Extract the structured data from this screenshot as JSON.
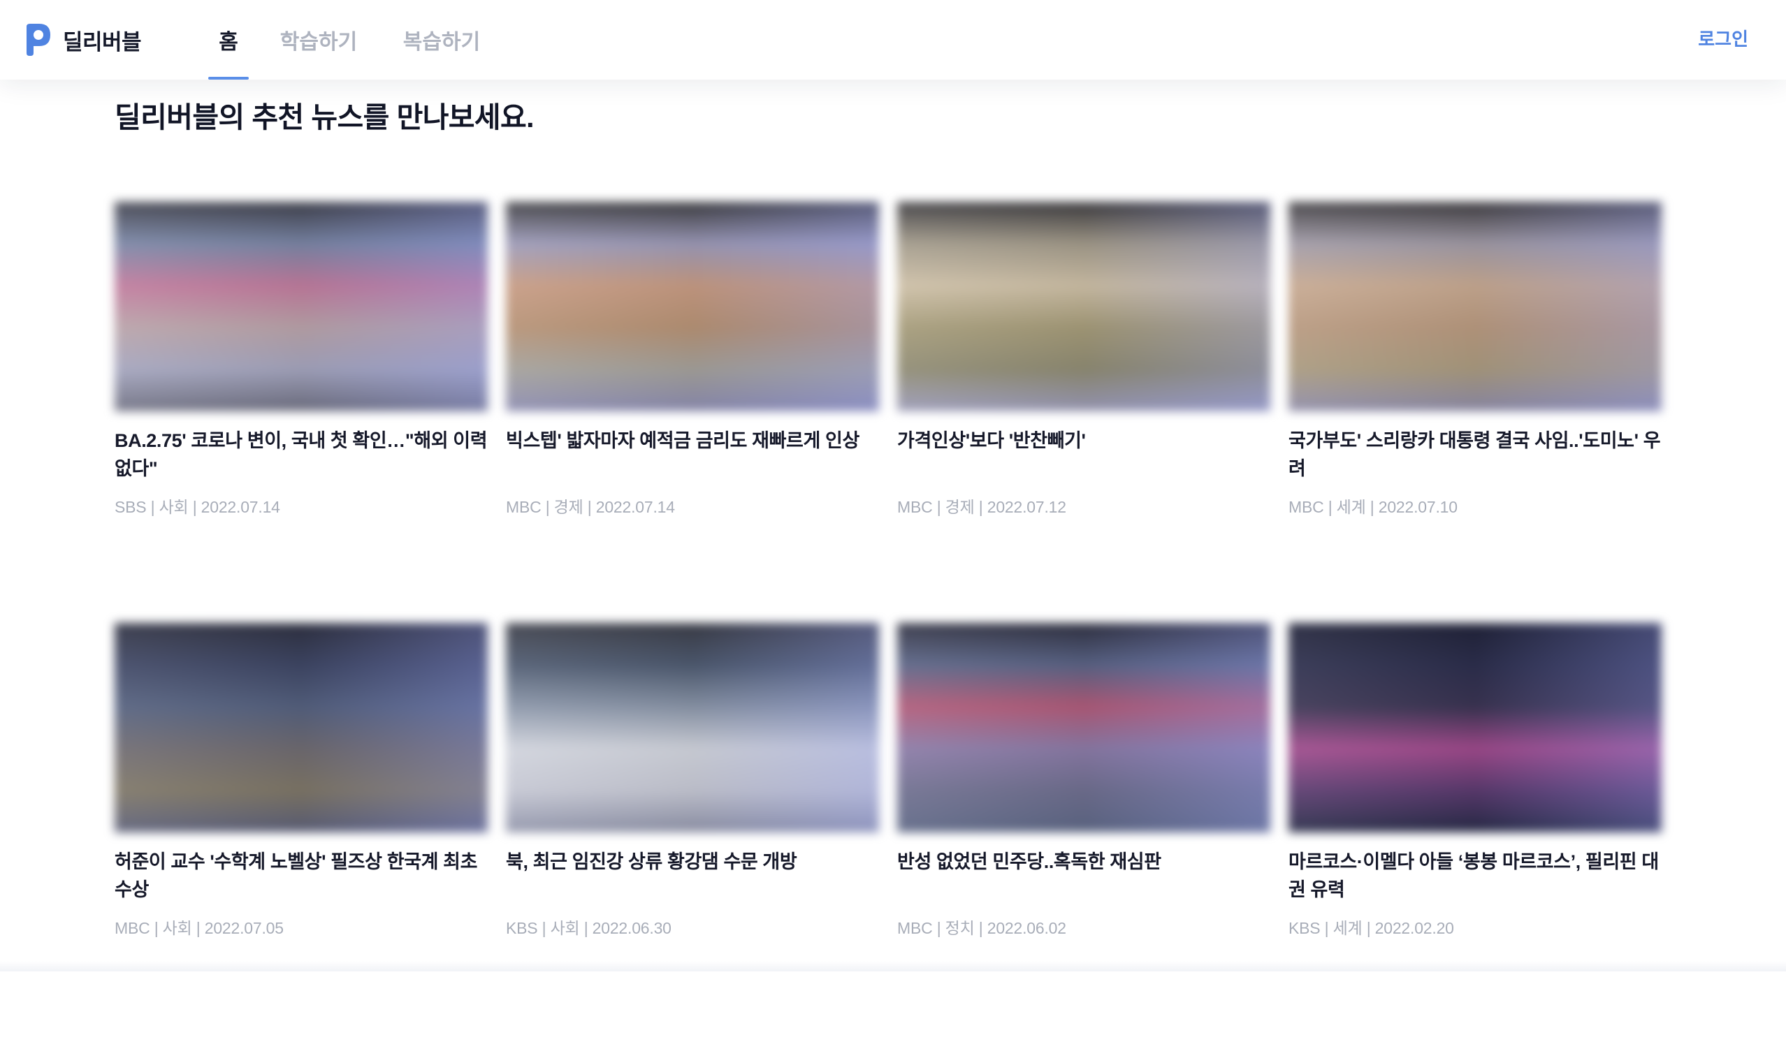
{
  "header": {
    "brand": "딜리버블",
    "nav": [
      {
        "label": "홈",
        "active": true
      },
      {
        "label": "학습하기",
        "active": false
      },
      {
        "label": "복습하기",
        "active": false
      }
    ],
    "login_label": "로그인",
    "accent_color": "#5a8ee8",
    "logo_color": "#4f83e1"
  },
  "main": {
    "title": "딜리버블의 추천 뉴스를 만나보세요.",
    "articles": [
      {
        "title": "BA.2.75' 코로나 변이, 국내 첫 확인…\"해외 이력 없다\"",
        "meta": "SBS | 사회 | 2022.07.14",
        "thumb": "blurred-image",
        "palette": [
          "#3e3f4a",
          "#7a86a6",
          "#c07a9c",
          "#b8a2a8",
          "#a3a4bd",
          "#6d6e80"
        ]
      },
      {
        "title": "빅스텝' 밟자마자 예적금 금리도 재빠르게 인상",
        "meta": "MBC | 경제 | 2022.07.14",
        "thumb": "blurred-image",
        "palette": [
          "#3c3c40",
          "#9c9ab8",
          "#c69a82",
          "#b59174",
          "#a3a09a",
          "#8a8ab0"
        ]
      },
      {
        "title": "가격인상'보다 '반찬빼기'",
        "meta": "MBC | 경제 | 2022.07.12",
        "thumb": "blurred-image",
        "palette": [
          "#3b3a3e",
          "#a29a8a",
          "#cdbfa6",
          "#a49a78",
          "#8e8a72",
          "#9a9ab8"
        ]
      },
      {
        "title": "국가부도' 스리랑카 대통령 결국 사임..'도미노' 우려",
        "meta": "MBC | 세계 | 2022.07.10",
        "thumb": "blurred-image",
        "palette": [
          "#3d3b3f",
          "#a09aa6",
          "#c6a890",
          "#b7987e",
          "#a8997e",
          "#8c8aa8"
        ]
      },
      {
        "title": "허준이 교수 '수학계 노벨상' 필즈상 한국계 최초 수상",
        "meta": "MBC | 사회 | 2022.07.05",
        "thumb": "blurred-image",
        "palette": [
          "#2e3040",
          "#3e4664",
          "#54607e",
          "#6e6a70",
          "#7e7666",
          "#5a5e78"
        ]
      },
      {
        "title": "북, 최근 임진강 상류 황강댐 수문 개방",
        "meta": "KBS | 사회 | 2022.06.30",
        "thumb": "blurred-image",
        "palette": [
          "#3a3c46",
          "#4e5a70",
          "#8a95a8",
          "#d0d3dc",
          "#c4c6d2",
          "#8e92a8"
        ]
      },
      {
        "title": "반성 없었던 민주당..혹독한 재심판",
        "meta": "MBC | 정치 | 2022.06.02",
        "thumb": "blurred-image",
        "palette": [
          "#2f3040",
          "#5a6486",
          "#b05a78",
          "#8a7aa6",
          "#6e6e8e",
          "#5c6684"
        ]
      },
      {
        "title": "마르코스·이멜다 아들 ‘봉봉 마르코스’, 필리핀 대권 유력",
        "meta": "KBS | 세계 | 2022.02.20",
        "thumb": "blurred-image",
        "palette": [
          "#202238",
          "#2c2e4c",
          "#3a3452",
          "#a04a8c",
          "#5a3a6e",
          "#262a46"
        ]
      }
    ]
  }
}
